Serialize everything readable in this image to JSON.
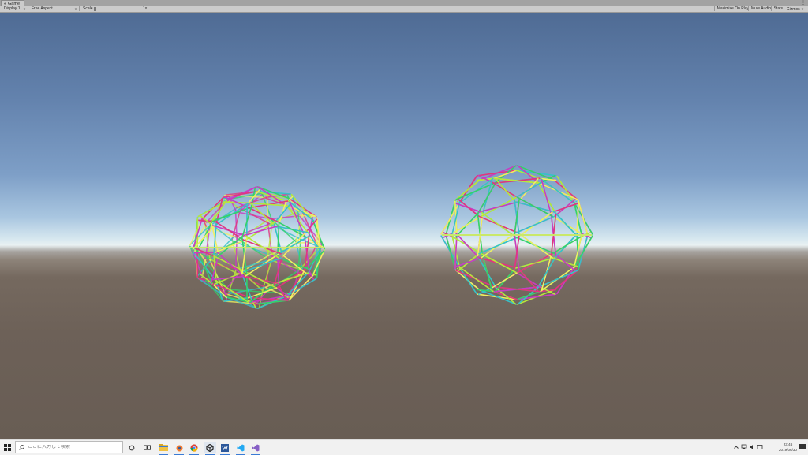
{
  "window": {
    "tab_title": "Game",
    "tab_menu_glyph": "⋮"
  },
  "toolbar": {
    "display": "Display 1",
    "aspect": "Free Aspect",
    "scale_label": "Scale",
    "scale_value": "1x",
    "scale_fraction": 0.0,
    "maximize_on_play": "Maximize On Play",
    "mute_audio": "Mute Audio",
    "stats": "Stats",
    "gizmos": "Gizmos"
  },
  "scene": {
    "objects": [
      "wireframe-sphere-left",
      "wireframe-sphere-right"
    ],
    "colors": [
      "#e0367f",
      "#36c1c9",
      "#b6e83a",
      "#35d16a",
      "#c93bc4",
      "#f0f060"
    ]
  },
  "taskbar": {
    "search_placeholder": "ここに入力して検索",
    "apps": [
      "task-view-icon",
      "file-explorer-icon",
      "blender-icon",
      "chrome-icon",
      "unity-icon",
      "word-icon",
      "vs-code-icon",
      "visual-studio-icon"
    ],
    "clock_time": "23:46",
    "clock_date": "2019/06/30"
  }
}
